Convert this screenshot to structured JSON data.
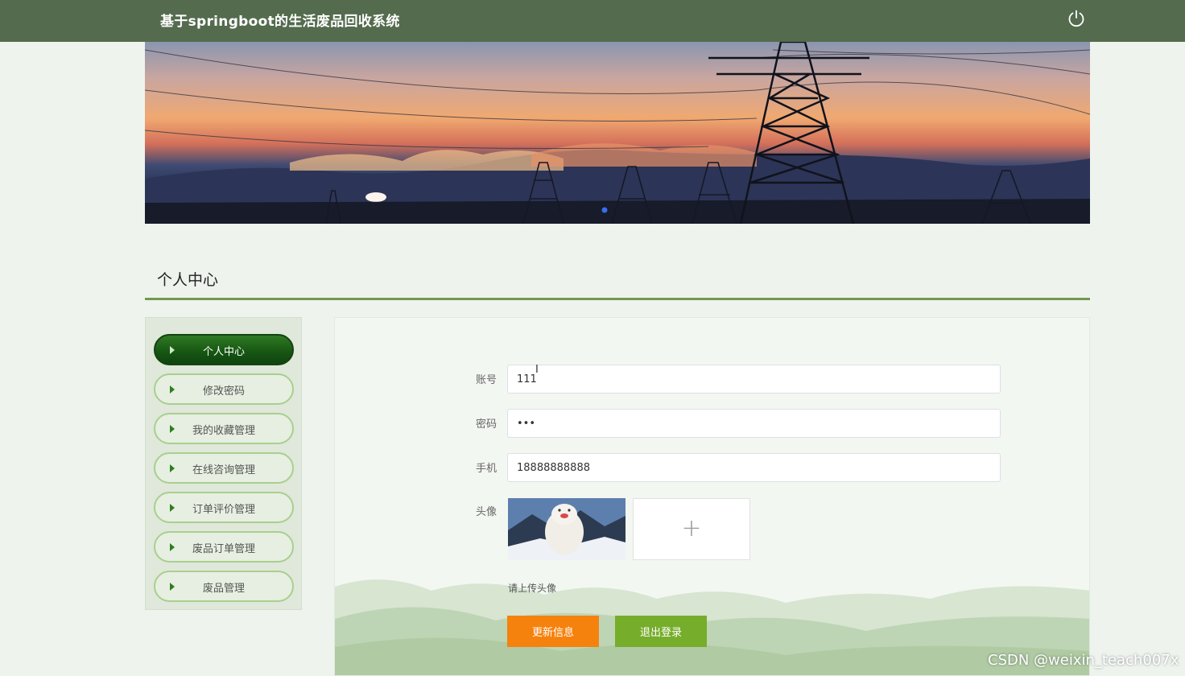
{
  "app": {
    "title": "基于springboot的生活废品回收系统"
  },
  "header": {
    "power_icon": "power-icon"
  },
  "page": {
    "section_title": "个人中心"
  },
  "sidebar": {
    "items": [
      {
        "label": "个人中心",
        "active": true
      },
      {
        "label": "修改密码",
        "active": false
      },
      {
        "label": "我的收藏管理",
        "active": false
      },
      {
        "label": "在线咨询管理",
        "active": false
      },
      {
        "label": "订单评价管理",
        "active": false
      },
      {
        "label": "废品订单管理",
        "active": false
      },
      {
        "label": "废品管理",
        "active": false
      }
    ]
  },
  "form": {
    "account_label": "账号",
    "account_value": "111",
    "password_label": "密码",
    "password_value": "•••",
    "phone_label": "手机",
    "phone_value": "18888888888",
    "avatar_label": "头像",
    "upload_plus": "+",
    "upload_hint": "请上传头像"
  },
  "buttons": {
    "update": "更新信息",
    "logout": "退出登录"
  },
  "watermark": "CSDN @weixin_teach007x",
  "colors": {
    "topbar": "#546b4e",
    "accent_green": "#6f9a4c",
    "update_button": "#f6820e",
    "logout_button": "#76ad2b"
  }
}
